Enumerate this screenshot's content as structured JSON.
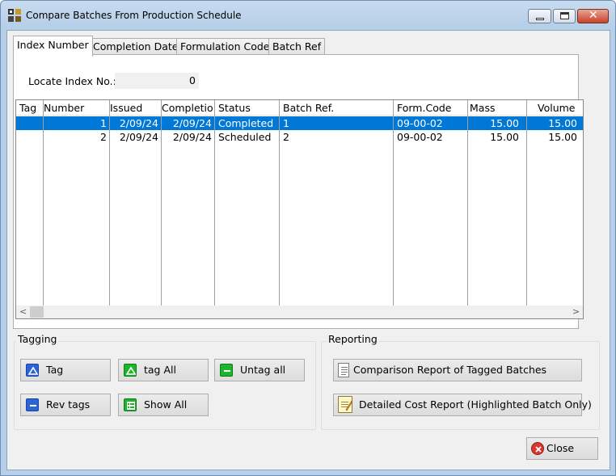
{
  "window": {
    "title": "Compare Batches From Production Schedule"
  },
  "tabs": [
    {
      "label": "Index Number"
    },
    {
      "label": "Completion Date"
    },
    {
      "label": "Formulation Code"
    },
    {
      "label": "Batch Ref"
    }
  ],
  "locate": {
    "label": "Locate Index No.:",
    "value": "0"
  },
  "grid": {
    "columns": [
      "Tag",
      "Number",
      "Issued",
      "Completion",
      "Status",
      "Batch Ref.",
      "Form.Code",
      "Mass",
      "Volume"
    ],
    "rows": [
      {
        "tag": "",
        "number": "1",
        "issued": "2/09/24",
        "completion": "2/09/24",
        "status": "Completed",
        "batch_ref": "1",
        "form_code": "09-00-02",
        "mass": "15.00",
        "volume": "15.00",
        "selected": true
      },
      {
        "tag": "",
        "number": "2",
        "issued": "2/09/24",
        "completion": "2/09/24",
        "status": "Scheduled",
        "batch_ref": "2",
        "form_code": "09-00-02",
        "mass": "15.00",
        "volume": "15.00",
        "selected": false
      }
    ]
  },
  "tagging": {
    "label": "Tagging",
    "tag": "Tag",
    "tag_all": "tag All",
    "untag_all": "Untag all",
    "rev_tags": "Rev tags",
    "show_all": "Show All"
  },
  "reporting": {
    "label": "Reporting",
    "comparison": "Comparison Report of Tagged Batches",
    "detailed": "Detailed Cost Report (Highlighted Batch Only)"
  },
  "close_label": "Close",
  "colors": {
    "selection": "#0078d7",
    "tag_icon_blue": "#2c64d8",
    "tag_icon_green": "#1db52d",
    "close_icon_red": "#d9382c"
  }
}
